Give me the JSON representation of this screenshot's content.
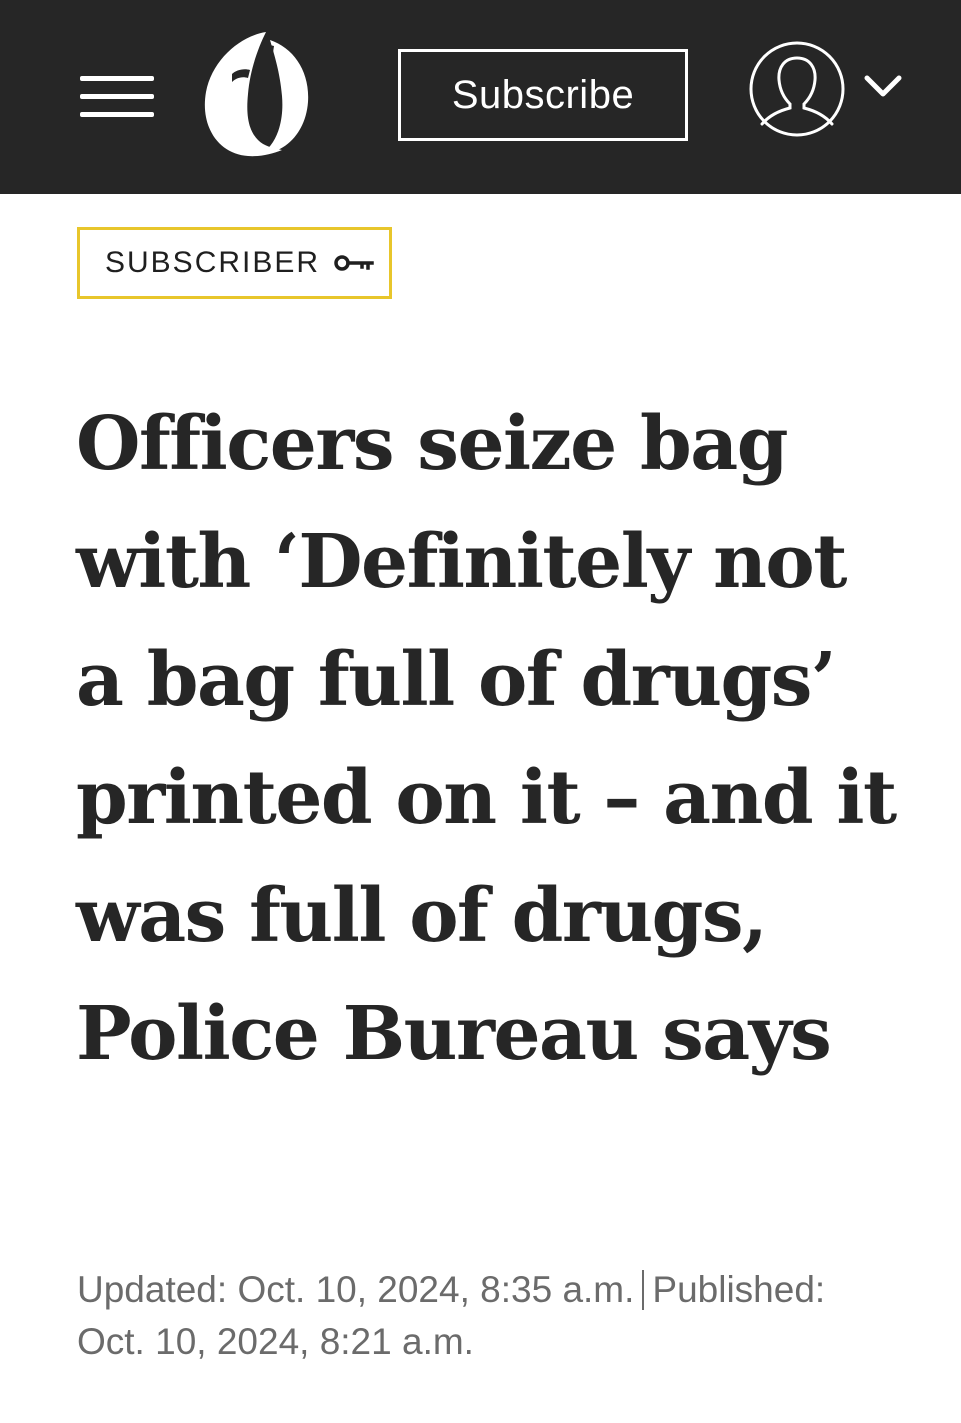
{
  "header": {
    "menu_icon": "hamburger-menu-icon",
    "logo_icon": "oregonian-o-logo",
    "subscribe_label": "Subscribe",
    "account_icon": "user-avatar-icon",
    "account_menu_icon": "chevron-down-icon",
    "background_color": "#262626"
  },
  "badge": {
    "label": "SUBSCRIBER",
    "icon": "key-icon",
    "border_color": "#e8c62b"
  },
  "article": {
    "headline": "Officers seize bag with ‘Definitely not a bag full of drugs’ printed on it – and it was full of drugs, Police Bureau says",
    "updated": "Updated: Oct. 10, 2024, 8:35 a.m.",
    "published_label": "Published:",
    "published_date": "Oct. 10, 2024, 8:21 a.m."
  }
}
